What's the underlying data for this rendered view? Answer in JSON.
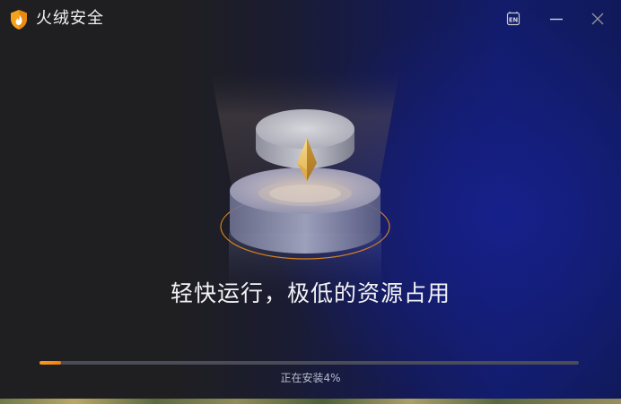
{
  "app": {
    "title": "火绒安全",
    "logo_icon": "huorong-shield-flame-icon"
  },
  "titlebar": {
    "language_button_text": "EN",
    "language_icon": "language-en-icon",
    "minimize_icon": "minimize-icon",
    "close_icon": "close-icon"
  },
  "illustration": {
    "icon": "lightweight-pedestal-crystal-icon"
  },
  "installer": {
    "slogan": "轻快运行，极低的资源占用",
    "status": "正在安装4%",
    "progress_percent": 4
  },
  "colors": {
    "accent": "#f5901a",
    "background_dark": "#1f1f21",
    "background_blue": "#121c6a",
    "progress_track": "#4a4c58"
  }
}
